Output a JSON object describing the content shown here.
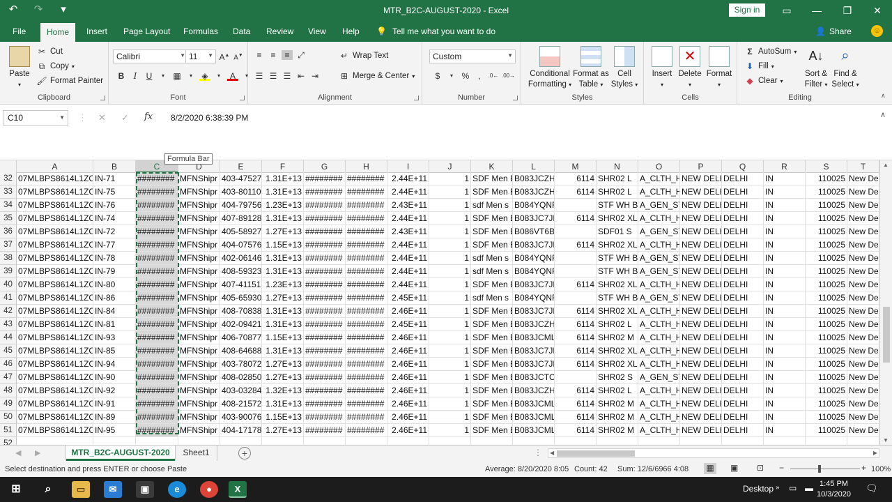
{
  "window": {
    "title": "MTR_B2C-AUGUST-2020  -  Excel",
    "signin": "Sign in"
  },
  "qat": {
    "undo_icon": "undo-icon",
    "redo_icon": "redo-icon",
    "customize": "▾"
  },
  "menu_tabs": [
    "File",
    "Home",
    "Insert",
    "Page Layout",
    "Formulas",
    "Data",
    "Review",
    "View",
    "Help"
  ],
  "tell_me": "Tell me what you want to do",
  "share": "Share",
  "ribbon": {
    "clipboard": {
      "paste": "Paste",
      "cut": "Cut",
      "copy": "Copy",
      "format_painter": "Format Painter",
      "label": "Clipboard"
    },
    "font": {
      "name": "Calibri",
      "size": "11",
      "bold": "B",
      "italic": "I",
      "underline": "U",
      "label": "Font"
    },
    "alignment": {
      "wrap_text": "Wrap Text",
      "merge_center": "Merge & Center",
      "label": "Alignment"
    },
    "number": {
      "format": "Custom",
      "currency": "$",
      "percent": "%",
      "comma": ",",
      "label": "Number"
    },
    "styles": {
      "conditional": "Conditional",
      "conditional2": "Formatting",
      "format_as": "Format as",
      "format_as2": "Table",
      "cell": "Cell",
      "cell2": "Styles",
      "label": "Styles"
    },
    "cells": {
      "insert": "Insert",
      "delete": "Delete",
      "format": "Format",
      "label": "Cells"
    },
    "editing": {
      "autosum": "AutoSum",
      "fill": "Fill",
      "clear": "Clear",
      "sort": "Sort &",
      "sort2": "Filter",
      "find": "Find &",
      "find2": "Select",
      "label": "Editing"
    }
  },
  "formula_bar": {
    "name_box": "C10",
    "fx": "fx",
    "content": "8/2/2020  6:38:39 PM",
    "tooltip": "Formula Bar"
  },
  "columns": [
    "A",
    "B",
    "C",
    "D",
    "E",
    "F",
    "G",
    "H",
    "I",
    "J",
    "K",
    "L",
    "M",
    "N",
    "O",
    "P",
    "Q",
    "R",
    "S",
    "T"
  ],
  "rows": [
    {
      "n": "32",
      "A": "07MLBPS8614L1ZC",
      "B": "IN-71",
      "C": "########",
      "D": "MFNShipr",
      "E": "403-47527",
      "F": "1.31E+13",
      "G": "########",
      "H": "########",
      "I": "2.44E+11",
      "J": "1",
      "K": "SDF Men E",
      "L": "B083JCZH\\",
      "M": "6114",
      "N": "SHR02 L",
      "O": "A_CLTH_H",
      "P": "NEW DELH",
      "Q": "DELHI",
      "R": "IN",
      "S": "110025",
      "T": "New De"
    },
    {
      "n": "33",
      "A": "07MLBPS8614L1ZC",
      "B": "IN-75",
      "C": "########",
      "D": "MFNShipr",
      "E": "403-80110",
      "F": "1.31E+13",
      "G": "########",
      "H": "########",
      "I": "2.44E+11",
      "J": "1",
      "K": "SDF Men E",
      "L": "B083JCZH\\",
      "M": "6114",
      "N": "SHR02 L",
      "O": "A_CLTH_H",
      "P": "NEW DELH",
      "Q": "DELHI",
      "R": "IN",
      "S": "110025",
      "T": "New De"
    },
    {
      "n": "34",
      "A": "07MLBPS8614L1ZC",
      "B": "IN-76",
      "C": "########",
      "D": "MFNShipr",
      "E": "404-79756",
      "F": "1.23E+13",
      "G": "########",
      "H": "########",
      "I": "2.43E+11",
      "J": "1",
      "K": "sdf Men s",
      "L": "B084YQNF3Y",
      "M": "",
      "N": "STF WH BL",
      "O": "A_GEN_ST",
      "P": "NEW DELH",
      "Q": "DELHI",
      "R": "IN",
      "S": "110025",
      "T": "New De"
    },
    {
      "n": "35",
      "A": "07MLBPS8614L1ZC",
      "B": "IN-74",
      "C": "########",
      "D": "MFNShipr",
      "E": "407-89128",
      "F": "1.31E+13",
      "G": "########",
      "H": "########",
      "I": "2.44E+11",
      "J": "1",
      "K": "SDF Men E",
      "L": "B083JC7JB",
      "M": "6114",
      "N": "SHR02 XL",
      "O": "A_CLTH_H",
      "P": "NEW DELH",
      "Q": "DELHI",
      "R": "IN",
      "S": "110025",
      "T": "New De"
    },
    {
      "n": "36",
      "A": "07MLBPS8614L1ZC",
      "B": "IN-72",
      "C": "########",
      "D": "MFNShipr",
      "E": "405-58927",
      "F": "1.27E+13",
      "G": "########",
      "H": "########",
      "I": "2.43E+11",
      "J": "1",
      "K": "SDF Men E",
      "L": "B086VT6BFR",
      "M": "",
      "N": "SDF01 S",
      "O": "A_GEN_ST",
      "P": "NEW DELH",
      "Q": "DELHI",
      "R": "IN",
      "S": "110025",
      "T": "New De"
    },
    {
      "n": "37",
      "A": "07MLBPS8614L1ZC",
      "B": "IN-77",
      "C": "########",
      "D": "MFNShipr",
      "E": "404-07576",
      "F": "1.15E+13",
      "G": "########",
      "H": "########",
      "I": "2.44E+11",
      "J": "1",
      "K": "SDF Men E",
      "L": "B083JC7JB",
      "M": "6114",
      "N": "SHR02 XL",
      "O": "A_CLTH_H",
      "P": "NEW DELH",
      "Q": "DELHI",
      "R": "IN",
      "S": "110025",
      "T": "New De"
    },
    {
      "n": "38",
      "A": "07MLBPS8614L1ZC",
      "B": "IN-78",
      "C": "########",
      "D": "MFNShipr",
      "E": "402-06146",
      "F": "1.31E+13",
      "G": "########",
      "H": "########",
      "I": "2.44E+11",
      "J": "1",
      "K": "sdf Men s",
      "L": "B084YQNF3Y",
      "M": "",
      "N": "STF WH BL",
      "O": "A_GEN_ST",
      "P": "NEW DELH",
      "Q": "DELHI",
      "R": "IN",
      "S": "110025",
      "T": "New De"
    },
    {
      "n": "39",
      "A": "07MLBPS8614L1ZC",
      "B": "IN-79",
      "C": "########",
      "D": "MFNShipr",
      "E": "408-59323",
      "F": "1.31E+13",
      "G": "########",
      "H": "########",
      "I": "2.44E+11",
      "J": "1",
      "K": "sdf Men s",
      "L": "B084YQNF3Y",
      "M": "",
      "N": "STF WH BL",
      "O": "A_GEN_ST",
      "P": "NEW DELH",
      "Q": "DELHI",
      "R": "IN",
      "S": "110025",
      "T": "New De"
    },
    {
      "n": "40",
      "A": "07MLBPS8614L1ZC",
      "B": "IN-80",
      "C": "########",
      "D": "MFNShipr",
      "E": "407-41151",
      "F": "1.23E+13",
      "G": "########",
      "H": "########",
      "I": "2.44E+11",
      "J": "1",
      "K": "SDF Men E",
      "L": "B083JC7JB",
      "M": "6114",
      "N": "SHR02 XL",
      "O": "A_CLTH_H",
      "P": "NEW DELH",
      "Q": "DELHI",
      "R": "IN",
      "S": "110025",
      "T": "New De"
    },
    {
      "n": "41",
      "A": "07MLBPS8614L1ZC",
      "B": "IN-86",
      "C": "########",
      "D": "MFNShipr",
      "E": "405-65930",
      "F": "1.27E+13",
      "G": "########",
      "H": "########",
      "I": "2.45E+11",
      "J": "1",
      "K": "sdf Men s",
      "L": "B084YQNF3Y",
      "M": "",
      "N": "STF WH BL",
      "O": "A_GEN_ST",
      "P": "NEW DELH",
      "Q": "DELHI",
      "R": "IN",
      "S": "110025",
      "T": "New De"
    },
    {
      "n": "42",
      "A": "07MLBPS8614L1ZC",
      "B": "IN-84",
      "C": "########",
      "D": "MFNShipr",
      "E": "408-70838",
      "F": "1.31E+13",
      "G": "########",
      "H": "########",
      "I": "2.46E+11",
      "J": "1",
      "K": "SDF Men E",
      "L": "B083JC7JB",
      "M": "6114",
      "N": "SHR02 XL",
      "O": "A_CLTH_H",
      "P": "NEW DELH",
      "Q": "DELHI",
      "R": "IN",
      "S": "110025",
      "T": "New De"
    },
    {
      "n": "43",
      "A": "07MLBPS8614L1ZC",
      "B": "IN-81",
      "C": "########",
      "D": "MFNShipr",
      "E": "402-09421",
      "F": "1.31E+13",
      "G": "########",
      "H": "########",
      "I": "2.45E+11",
      "J": "1",
      "K": "SDF Men E",
      "L": "B083JCZH\\",
      "M": "6114",
      "N": "SHR02 L",
      "O": "A_CLTH_H",
      "P": "NEW DELH",
      "Q": "DELHI",
      "R": "IN",
      "S": "110025",
      "T": "New De"
    },
    {
      "n": "44",
      "A": "07MLBPS8614L1ZC",
      "B": "IN-93",
      "C": "########",
      "D": "MFNShipr",
      "E": "406-70877",
      "F": "1.15E+13",
      "G": "########",
      "H": "########",
      "I": "2.46E+11",
      "J": "1",
      "K": "SDF Men E",
      "L": "B083JCML",
      "M": "6114",
      "N": "SHR02 M",
      "O": "A_CLTH_H",
      "P": "NEW DELH",
      "Q": "DELHI",
      "R": "IN",
      "S": "110025",
      "T": "New De"
    },
    {
      "n": "45",
      "A": "07MLBPS8614L1ZC",
      "B": "IN-85",
      "C": "########",
      "D": "MFNShipr",
      "E": "408-64688",
      "F": "1.31E+13",
      "G": "########",
      "H": "########",
      "I": "2.46E+11",
      "J": "1",
      "K": "SDF Men E",
      "L": "B083JC7JB",
      "M": "6114",
      "N": "SHR02 XL",
      "O": "A_CLTH_H",
      "P": "NEW DELH",
      "Q": "DELHI",
      "R": "IN",
      "S": "110025",
      "T": "New De"
    },
    {
      "n": "46",
      "A": "07MLBPS8614L1ZC",
      "B": "IN-94",
      "C": "########",
      "D": "MFNShipr",
      "E": "403-78072",
      "F": "1.27E+13",
      "G": "########",
      "H": "########",
      "I": "2.46E+11",
      "J": "1",
      "K": "SDF Men E",
      "L": "B083JC7JB",
      "M": "6114",
      "N": "SHR02 XL",
      "O": "A_CLTH_H",
      "P": "NEW DELH",
      "Q": "DELHI",
      "R": "IN",
      "S": "110025",
      "T": "New De"
    },
    {
      "n": "47",
      "A": "07MLBPS8614L1ZC",
      "B": "IN-90",
      "C": "########",
      "D": "MFNShipr",
      "E": "408-02850",
      "F": "1.27E+13",
      "G": "########",
      "H": "########",
      "I": "2.46E+11",
      "J": "1",
      "K": "SDF Men E",
      "L": "B083JCTC6L",
      "M": "",
      "N": "SHR02 S",
      "O": "A_GEN_ST",
      "P": "NEW DELH",
      "Q": "DELHI",
      "R": "IN",
      "S": "110025",
      "T": "New De"
    },
    {
      "n": "48",
      "A": "07MLBPS8614L1ZC",
      "B": "IN-92",
      "C": "########",
      "D": "MFNShipr",
      "E": "403-03284",
      "F": "1.32E+13",
      "G": "########",
      "H": "########",
      "I": "2.46E+11",
      "J": "1",
      "K": "SDF Men E",
      "L": "B083JCZH\\",
      "M": "6114",
      "N": "SHR02 L",
      "O": "A_CLTH_H",
      "P": "NEW DELH",
      "Q": "DELHI",
      "R": "IN",
      "S": "110025",
      "T": "New De"
    },
    {
      "n": "49",
      "A": "07MLBPS8614L1ZC",
      "B": "IN-91",
      "C": "########",
      "D": "MFNShipr",
      "E": "408-21572",
      "F": "1.31E+13",
      "G": "########",
      "H": "########",
      "I": "2.46E+11",
      "J": "1",
      "K": "SDF Men E",
      "L": "B083JCML",
      "M": "6114",
      "N": "SHR02 M",
      "O": "A_CLTH_H",
      "P": "NEW DELH",
      "Q": "DELHI",
      "R": "IN",
      "S": "110025",
      "T": "New De"
    },
    {
      "n": "50",
      "A": "07MLBPS8614L1ZC",
      "B": "IN-89",
      "C": "########",
      "D": "MFNShipr",
      "E": "403-90076",
      "F": "1.15E+13",
      "G": "########",
      "H": "########",
      "I": "2.46E+11",
      "J": "1",
      "K": "SDF Men E",
      "L": "B083JCML",
      "M": "6114",
      "N": "SHR02 M",
      "O": "A_CLTH_H",
      "P": "NEW DELH",
      "Q": "DELHI",
      "R": "IN",
      "S": "110025",
      "T": "New De"
    },
    {
      "n": "51",
      "A": "07MLBPS8614L1ZC",
      "B": "IN-95",
      "C": "########",
      "D": "MFNShipr",
      "E": "404-17178",
      "F": "1.27E+13",
      "G": "########",
      "H": "########",
      "I": "2.46E+11",
      "J": "1",
      "K": "SDF Men E",
      "L": "B083JCML",
      "M": "6114",
      "N": "SHR02 M",
      "O": "A_CLTH_H",
      "P": "NEW DELH",
      "Q": "DELHI",
      "R": "IN",
      "S": "110025",
      "T": "New De"
    },
    {
      "n": "52",
      "A": "",
      "B": "",
      "C": "",
      "D": "",
      "E": "",
      "F": "",
      "G": "",
      "H": "",
      "I": "",
      "J": "",
      "K": "",
      "L": "",
      "M": "",
      "N": "",
      "O": "",
      "P": "",
      "Q": "",
      "R": "",
      "S": "",
      "T": ""
    }
  ],
  "sheets": {
    "active": "MTR_B2C-AUGUST-2020",
    "other": "Sheet1",
    "add": "+"
  },
  "status": {
    "message": "Select destination and press ENTER or choose Paste",
    "average": "Average: 8/20/2020 8:05",
    "count": "Count: 42",
    "sum": "Sum: 12/6/6966 4:08",
    "zoom": "100%"
  },
  "taskbar": {
    "desktop": "Desktop",
    "time": "1:45 PM",
    "date": "10/3/2020"
  },
  "colors": {
    "excel_green": "#217346",
    "selection_gray": "#d9d9d9",
    "taskbar": "#1c1c1c"
  }
}
